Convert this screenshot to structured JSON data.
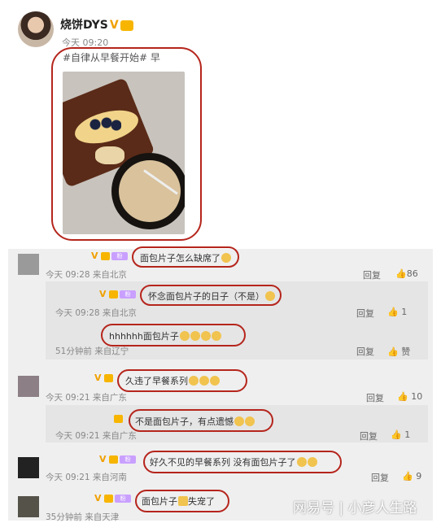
{
  "post": {
    "author": "烧饼DYS",
    "verified": "V",
    "time": "今天 09:20",
    "text": "#自律从早餐开始# 早"
  },
  "comments": [
    {
      "time": "今天 09:28 来自北京",
      "text": "面包片子怎么缺席了",
      "reply_label": "回复",
      "likes": "86",
      "replies": [
        {
          "time": "今天 09:28 来自北京",
          "text": "怀念面包片子的日子（不是）",
          "reply_label": "回复",
          "likes": "1"
        },
        {
          "time": "51分钟前 来自辽宁",
          "text": "hhhhhh面包片子",
          "reply_label": "回复",
          "likes": "赞"
        }
      ]
    },
    {
      "time": "今天 09:21 来自广东",
      "text": "久违了早餐系列",
      "reply_label": "回复",
      "likes": "10",
      "replies": [
        {
          "time": "今天 09:21 来自广东",
          "text": "不是面包片子，有点遗憾",
          "reply_label": "回复",
          "likes": "1"
        }
      ]
    },
    {
      "time": "今天 09:21 来自河南",
      "text": "好久不见的早餐系列 没有面包片子了",
      "reply_label": "回复",
      "likes": "9",
      "replies": []
    },
    {
      "time": "35分钟前 来自天津",
      "text": "面包片子",
      "text2": "失宠了",
      "reply_label": "回复",
      "likes": "",
      "replies": []
    }
  ],
  "watermark": "网易号 | 小彦人生路",
  "colors": {
    "highlight": "#b5251c",
    "verified": "#f0a000",
    "panel": "#efefef"
  }
}
